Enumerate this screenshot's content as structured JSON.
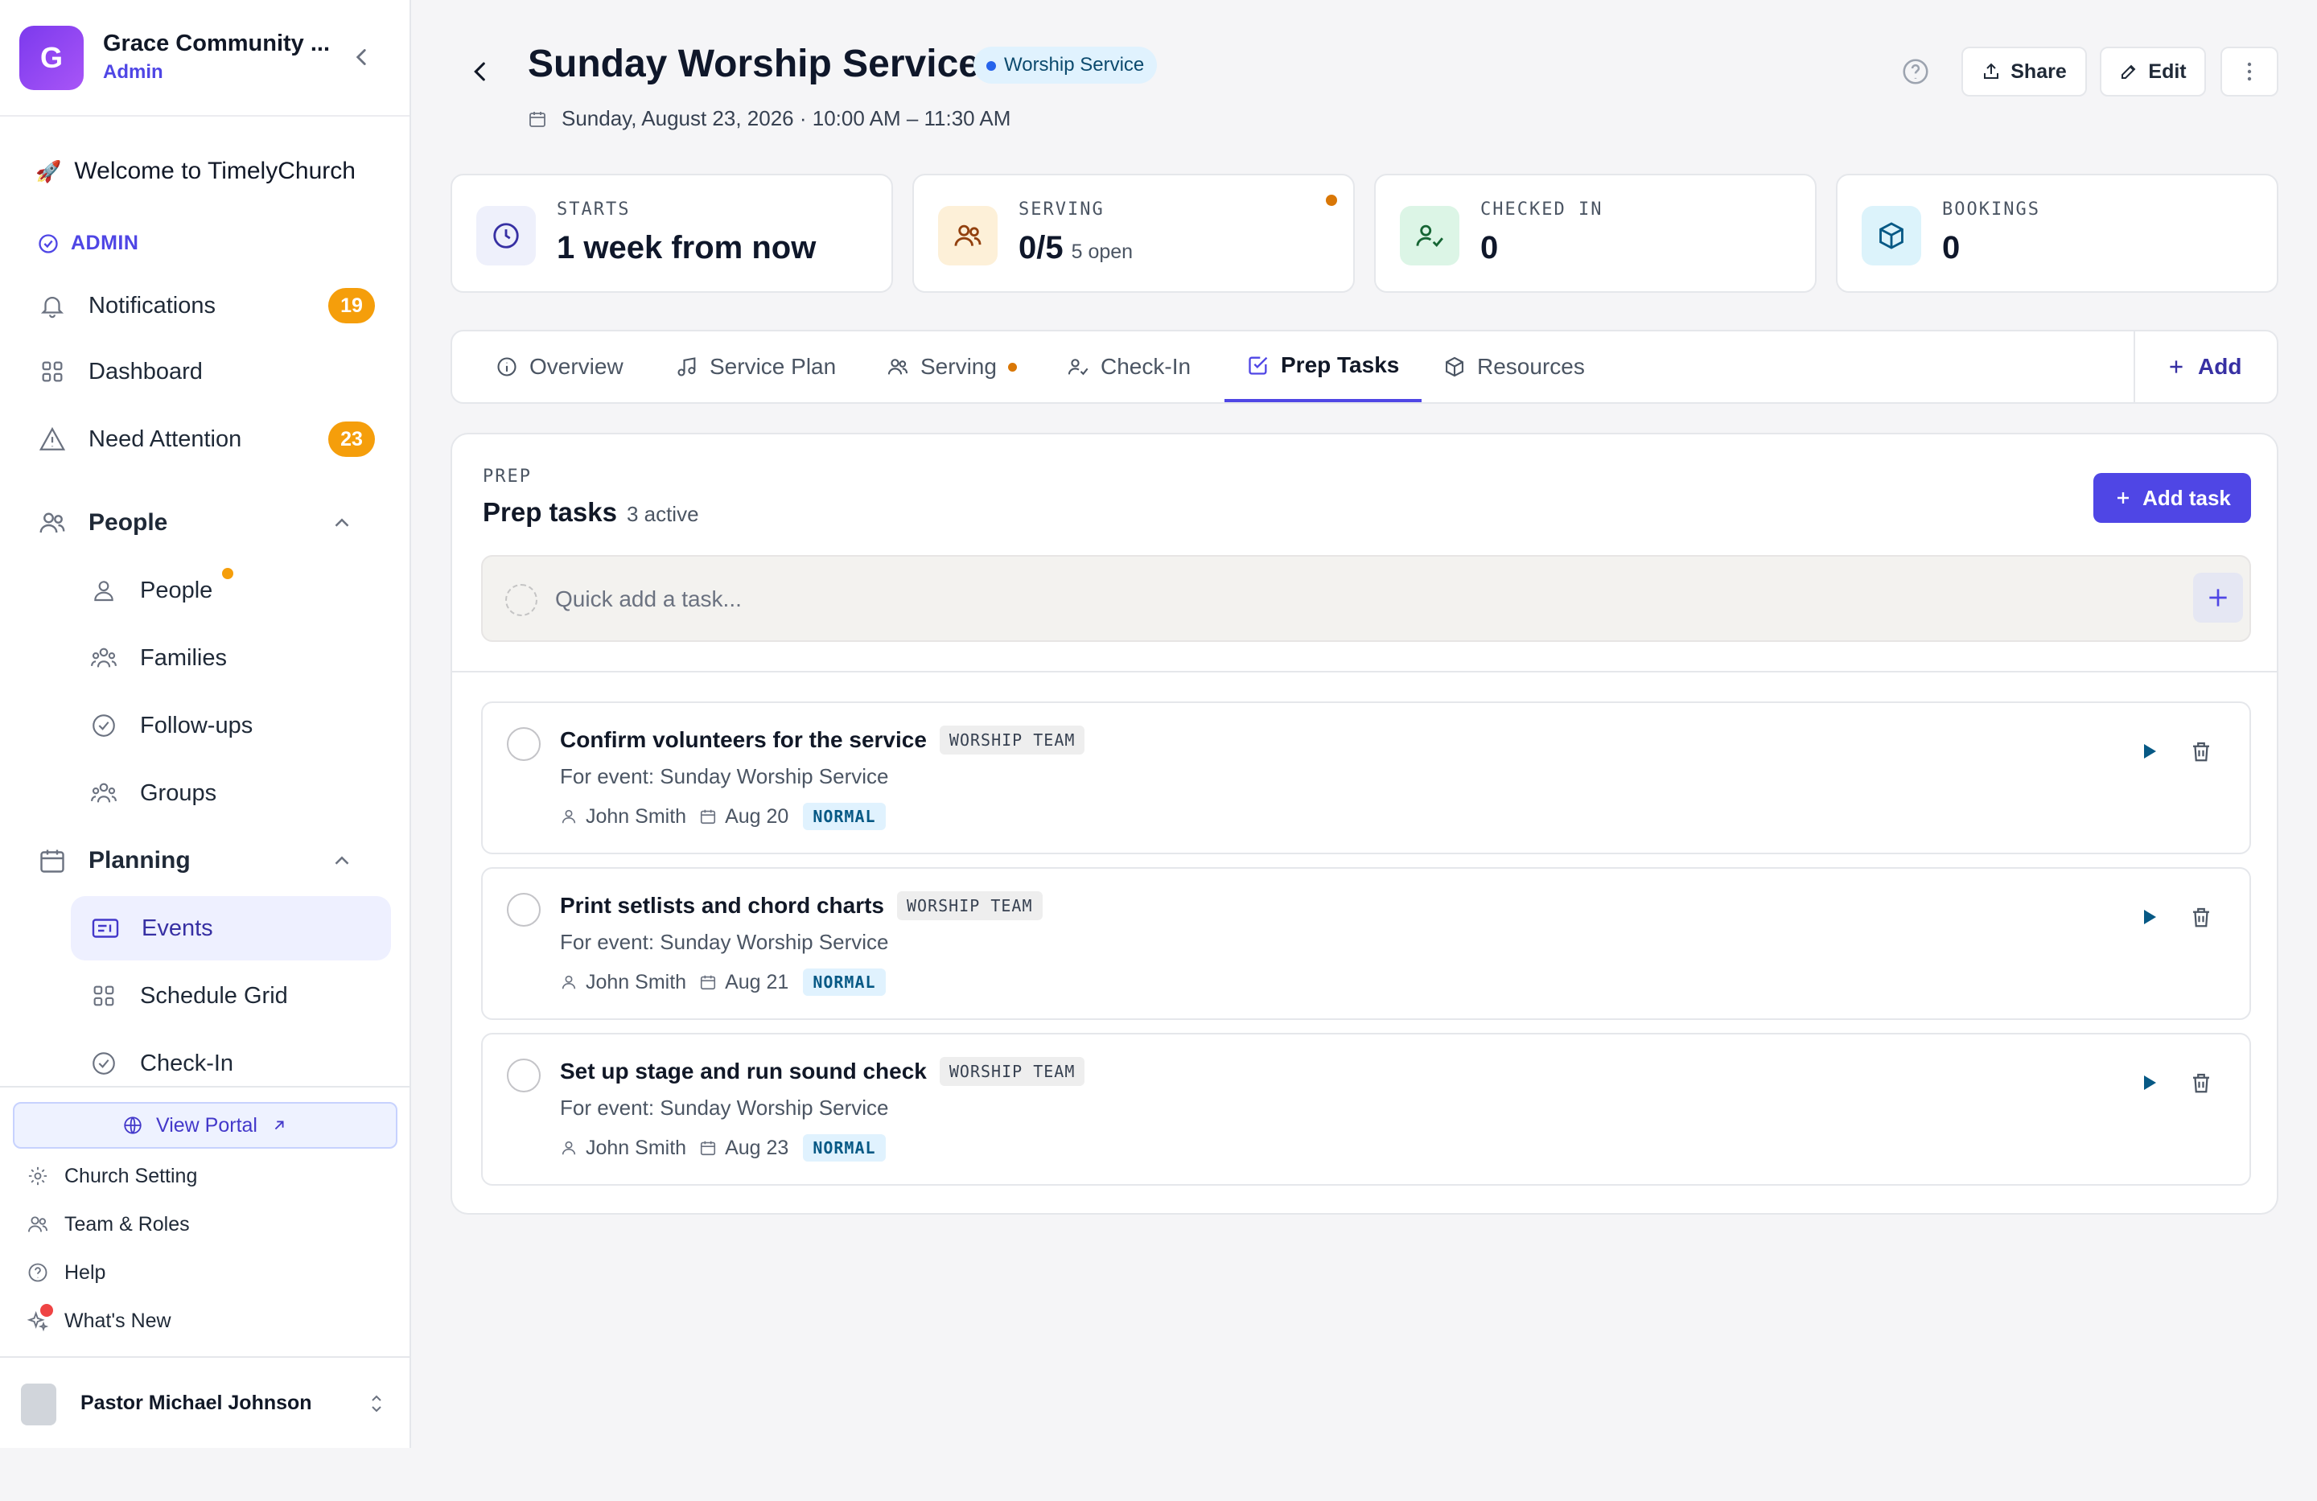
{
  "sidebar": {
    "church_initial": "G",
    "church_name": "Grace Community ...",
    "church_role": "Admin",
    "welcome": "Welcome to TimelyChurch",
    "admin_label": "ADMIN",
    "items": [
      {
        "label": "Notifications",
        "icon": "bell-icon",
        "badge": "19"
      },
      {
        "label": "Dashboard",
        "icon": "grid-icon"
      },
      {
        "label": "Need Attention",
        "icon": "warning-icon",
        "badge": "23"
      }
    ],
    "people_section": "People",
    "people_items": [
      "People",
      "Families",
      "Follow-ups",
      "Groups"
    ],
    "planning_section": "Planning",
    "planning_items": [
      "Events",
      "Schedule Grid",
      "Check-In"
    ],
    "view_portal": "View Portal",
    "footer_items": [
      "Church Setting",
      "Team & Roles",
      "Help",
      "What's New"
    ],
    "user_name": "Pastor Michael Johnson"
  },
  "header": {
    "title": "Sunday Worship Service",
    "type_badge": "Worship Service",
    "datetime": "Sunday, August 23, 2026 · 10:00 AM – 11:30 AM",
    "share_label": "Share",
    "edit_label": "Edit"
  },
  "stats": [
    {
      "label": "STARTS",
      "value": "1 week from now",
      "sub": ""
    },
    {
      "label": "SERVING",
      "value": "0/5",
      "sub": "5 open"
    },
    {
      "label": "CHECKED IN",
      "value": "0",
      "sub": ""
    },
    {
      "label": "BOOKINGS",
      "value": "0",
      "sub": ""
    }
  ],
  "tabs": {
    "items": [
      "Overview",
      "Service Plan",
      "Serving",
      "Check-In",
      "Prep Tasks",
      "Resources"
    ],
    "active": "Prep Tasks",
    "add_label": "Add"
  },
  "prep": {
    "kicker": "PREP",
    "title": "Prep tasks",
    "count_text": "3 active",
    "add_task_label": "Add task",
    "quick_add_placeholder": "Quick add a task...",
    "tasks": [
      {
        "title": "Confirm volunteers for the service",
        "team": "WORSHIP TEAM",
        "event": "For event: Sunday Worship Service",
        "assignee": "John Smith",
        "due": "Aug 20",
        "priority": "NORMAL"
      },
      {
        "title": "Print setlists and chord charts",
        "team": "WORSHIP TEAM",
        "event": "For event: Sunday Worship Service",
        "assignee": "John Smith",
        "due": "Aug 21",
        "priority": "NORMAL"
      },
      {
        "title": "Set up stage and run sound check",
        "team": "WORSHIP TEAM",
        "event": "For event: Sunday Worship Service",
        "assignee": "John Smith",
        "due": "Aug 23",
        "priority": "NORMAL"
      }
    ]
  },
  "colors": {
    "accent": "#4f46e5",
    "badge_orange": "#f59e0b",
    "serving_dot": "#d97706"
  }
}
